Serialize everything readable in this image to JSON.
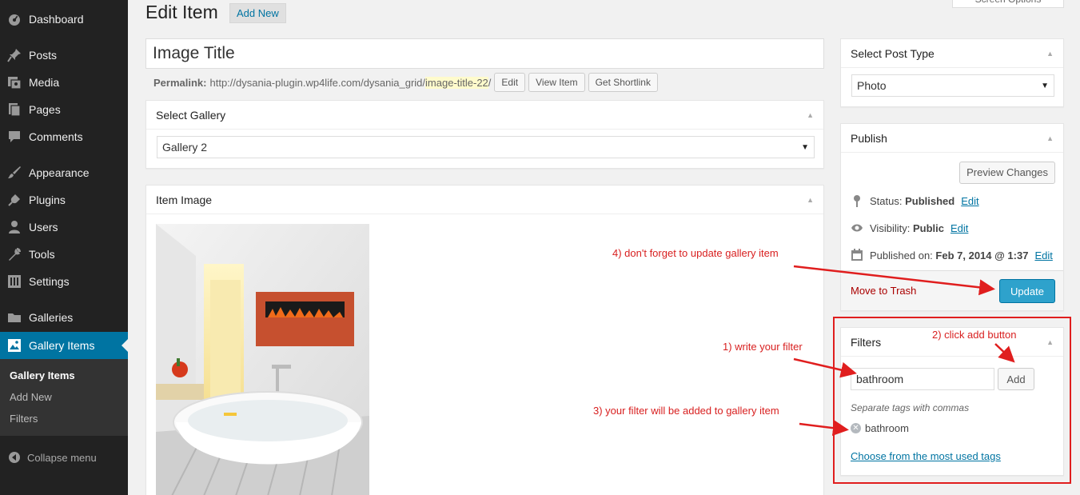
{
  "sidebar": {
    "items": [
      {
        "label": "Dashboard",
        "icon": "dashboard-icon"
      },
      {
        "label": "Posts",
        "icon": "pin-icon"
      },
      {
        "label": "Media",
        "icon": "media-icon"
      },
      {
        "label": "Pages",
        "icon": "pages-icon"
      },
      {
        "label": "Comments",
        "icon": "comment-icon"
      },
      {
        "label": "Appearance",
        "icon": "brush-icon"
      },
      {
        "label": "Plugins",
        "icon": "plug-icon"
      },
      {
        "label": "Users",
        "icon": "user-icon"
      },
      {
        "label": "Tools",
        "icon": "wrench-icon"
      },
      {
        "label": "Settings",
        "icon": "settings-icon"
      },
      {
        "label": "Galleries",
        "icon": "folder-icon"
      },
      {
        "label": "Gallery Items",
        "icon": "gallery-icon"
      }
    ],
    "submenu": [
      "Gallery Items",
      "Add New",
      "Filters"
    ],
    "collapse_label": "Collapse menu"
  },
  "header": {
    "title": "Edit Item",
    "add_new": "Add New",
    "screen_options": "Screen Options"
  },
  "post": {
    "title": "Image Title",
    "permalink_label": "Permalink:",
    "permalink_base": "http://dysania-plugin.wp4life.com/dysania_grid/",
    "permalink_slug": "image-title-22",
    "permalink_tail": "/",
    "edit_btn": "Edit",
    "view_btn": "View Item",
    "shortlink_btn": "Get Shortlink"
  },
  "gallery_box": {
    "title": "Select Gallery",
    "value": "Gallery 2"
  },
  "image_box": {
    "title": "Item Image"
  },
  "post_type_box": {
    "title": "Select Post Type",
    "value": "Photo"
  },
  "publish": {
    "title": "Publish",
    "preview": "Preview Changes",
    "status_label": "Status:",
    "status_value": "Published",
    "visibility_label": "Visibility:",
    "visibility_value": "Public",
    "published_label": "Published on:",
    "published_value": "Feb 7, 2014 @ 1:37",
    "edit_link": "Edit",
    "trash": "Move to Trash",
    "update": "Update"
  },
  "filters": {
    "title": "Filters",
    "input_value": "bathroom",
    "add": "Add",
    "hint": "Separate tags with commas",
    "tag": "bathroom",
    "most_used": "Choose from the most used tags"
  },
  "annotations": {
    "step1": "1) write your filter",
    "step2": "2) click add button",
    "step3": "3) your filter will be added to gallery item",
    "step4": "4) don't forget to update gallery item"
  },
  "colors": {
    "sidebar_bg": "#222222",
    "active_menu": "#0074a2",
    "primary_button": "#2ea2cc",
    "link": "#0074a2",
    "annotation": "#e01e1e"
  }
}
